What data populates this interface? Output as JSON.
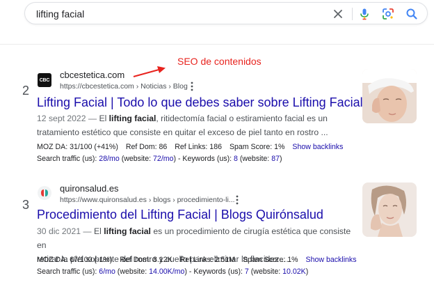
{
  "search": {
    "query": "lifting facial",
    "icons": [
      "clear-icon",
      "microphone-icon",
      "google-lens-icon",
      "search-icon"
    ]
  },
  "annotation": {
    "text": "SEO de contenidos",
    "color": "#e8231e"
  },
  "results": [
    {
      "rank": "2",
      "favicon": "CBC",
      "site_name": "cbcestetica.com",
      "url": "https://cbcestetica.com › Noticias › Blog",
      "title": "Lifting Facial | Todo lo que debes saber sobre Lifting Facial",
      "date": "12 sept 2022 — ",
      "snippet_pre": "El ",
      "snippet_bold": "lifting facial",
      "snippet_line1_post": ", ritidectomía facial o estiramiento facial es un",
      "snippet_line2": "tratamiento estético que consiste en quitar el exceso de piel tanto en rostro ...",
      "metrics": {
        "moz_da": "MOZ DA: 31/100 (+41%)",
        "ref_dom": "Ref Dom: 86",
        "ref_links": "Ref Links: 186",
        "spam_score": "Spam Score: 1%",
        "show_backlinks": "Show backlinks"
      },
      "traffic": {
        "label": "Search traffic (us): ",
        "traffic_value": "28/mo",
        "website_label": " (website: ",
        "website_value": "72/mo",
        "keywords_label": ") - Keywords (us): ",
        "keywords_value": "8",
        "kw_website_label": " (website: ",
        "kw_website_value": "87",
        "close": ")"
      }
    },
    {
      "rank": "3",
      "favicon": "quironsalud-logo",
      "site_name": "quironsalud.es",
      "url": "https://www.quironsalud.es › blogs › procedimiento-li...",
      "title": "Procedimiento del Lifting Facial | Blogs Quirónsalud",
      "date": "30 dic 2021 — ",
      "snippet_pre": "El ",
      "snippet_bold": "lifting facial",
      "snippet_line1_post": " es un procedimiento de cirugía estética que consiste en",
      "snippet_line2": "retirar la piel sobrante del rostro y cuello para eliminar la flacidez ...",
      "metrics": {
        "moz_da": "MOZ DA: 67/100 (-1%)",
        "ref_dom": "Ref Dom: 8.12K",
        "ref_links": "Ref Links: 2.51M",
        "spam_score": "Spam Score: 1%",
        "show_backlinks": "Show backlinks"
      },
      "traffic": {
        "label": "Search traffic (us): ",
        "traffic_value": "6/mo",
        "website_label": " (website: ",
        "website_value": "14.00K/mo",
        "keywords_label": ") - Keywords (us): ",
        "keywords_value": "7",
        "kw_website_label": " (website: ",
        "kw_website_value": "10.02K",
        "close": ")"
      }
    }
  ],
  "colors": {
    "link": "#1a0dab",
    "text": "#202124",
    "muted": "#4d5156",
    "annotation": "#e8231e"
  }
}
